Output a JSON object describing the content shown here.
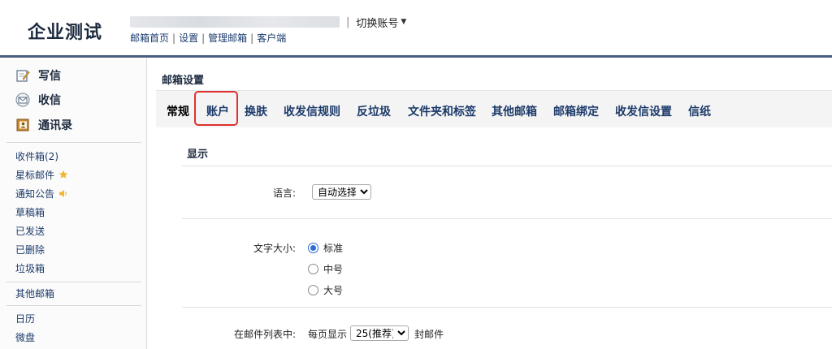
{
  "header": {
    "logo": "企业测试",
    "account_separator": "|",
    "switch_account": "切换账号",
    "links": [
      "邮箱首页",
      "设置",
      "管理邮箱",
      "客户端"
    ],
    "link_separator": "|"
  },
  "sidebar": {
    "actions": [
      {
        "label": "写信",
        "icon": "compose-icon"
      },
      {
        "label": "收信",
        "icon": "inbox-icon"
      },
      {
        "label": "通讯录",
        "icon": "address-book-icon"
      }
    ],
    "folders": [
      {
        "label": "收件箱(2)",
        "icon": ""
      },
      {
        "label": "星标邮件",
        "icon": "star-icon"
      },
      {
        "label": "通知公告",
        "icon": "speaker-icon"
      },
      {
        "label": "草稿箱",
        "icon": ""
      },
      {
        "label": "已发送",
        "icon": ""
      },
      {
        "label": "已删除",
        "icon": ""
      },
      {
        "label": "垃圾箱",
        "icon": ""
      }
    ],
    "other_mailboxes": "其他邮箱",
    "apps": [
      "日历",
      "微盘"
    ]
  },
  "main": {
    "title": "邮箱设置",
    "tabs": [
      "常规",
      "账户",
      "换肤",
      "收发信规则",
      "反垃圾",
      "文件夹和标签",
      "其他邮箱",
      "邮箱绑定",
      "收发信设置",
      "信纸"
    ],
    "active_tab": "常规",
    "highlighted_tab": "账户",
    "section_title": "显示",
    "language": {
      "label": "语言:",
      "value": "自动选择"
    },
    "font_size": {
      "label": "文字大小:",
      "options": [
        "标准",
        "中号",
        "大号"
      ],
      "selected": "标准"
    },
    "list_display": {
      "label": "在邮件列表中:",
      "prefix": "每页显示",
      "value": "25(推荐)",
      "suffix": "封邮件"
    }
  },
  "colors": {
    "header_bar": "#4a5f7e",
    "link": "#1c3a6a",
    "highlight_box": "#e0312e",
    "radio_accent": "#2d6bd6",
    "star": "#f2b630",
    "speaker": "#f2b630"
  }
}
